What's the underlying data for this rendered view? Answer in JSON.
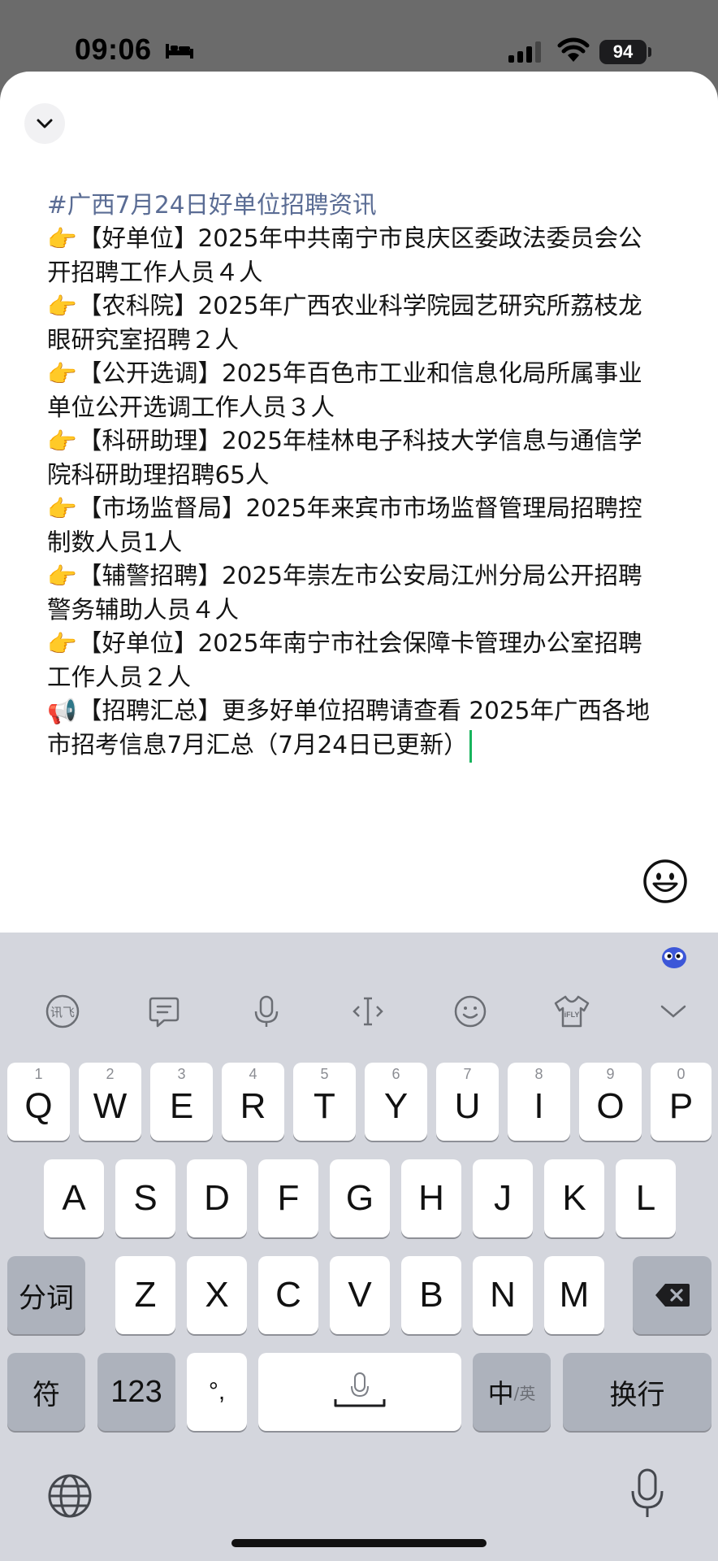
{
  "status_bar": {
    "time": "09:06",
    "battery": "94"
  },
  "editor": {
    "hashtag": "#广西7月24日好单位招聘资讯",
    "items": [
      {
        "icon": "👉",
        "text": "【好单位】2025年中共南宁市良庆区委政法委员会公开招聘工作人员４人"
      },
      {
        "icon": "👉",
        "text": "【农科院】2025年广西农业科学院园艺研究所荔枝龙眼研究室招聘２人"
      },
      {
        "icon": "👉",
        "text": "【公开选调】2025年百色市工业和信息化局所属事业单位公开选调工作人员３人"
      },
      {
        "icon": "👉",
        "text": "【科研助理】2025年桂林电子科技大学信息与通信学院科研助理招聘65人"
      },
      {
        "icon": "👉",
        "text": "【市场监督局】2025年来宾市市场监督管理局招聘控制数人员1人"
      },
      {
        "icon": "👉",
        "text": "【辅警招聘】2025年崇左市公安局江州分局公开招聘警务辅助人员４人"
      },
      {
        "icon": "👉",
        "text": "【好单位】2025年南宁市社会保障卡管理办公室招聘工作人员２人"
      },
      {
        "icon": "📢",
        "text": "【招聘汇总】更多好单位招聘请查看 2025年广西各地市招考信息7月汇总（7月24日已更新）"
      }
    ]
  },
  "keyboard": {
    "row1": [
      {
        "num": "1",
        "label": "Q"
      },
      {
        "num": "2",
        "label": "W"
      },
      {
        "num": "3",
        "label": "E"
      },
      {
        "num": "4",
        "label": "R"
      },
      {
        "num": "5",
        "label": "T"
      },
      {
        "num": "6",
        "label": "Y"
      },
      {
        "num": "7",
        "label": "U"
      },
      {
        "num": "8",
        "label": "I"
      },
      {
        "num": "9",
        "label": "O"
      },
      {
        "num": "0",
        "label": "P"
      }
    ],
    "row2": [
      "A",
      "S",
      "D",
      "F",
      "G",
      "H",
      "J",
      "K",
      "L"
    ],
    "row3": [
      "Z",
      "X",
      "C",
      "V",
      "B",
      "N",
      "M"
    ],
    "segment_key": "分词",
    "symbol_key": "符",
    "number_key": "123",
    "punct_key": "°,",
    "lang_key_main": "中",
    "lang_key_sub": "/英",
    "enter_key": "换行",
    "toolbar_icons": [
      "ifly-logo-icon",
      "clipboard-icon",
      "microphone-icon",
      "cursor-move-icon",
      "emoji-icon",
      "skin-shirt-icon",
      "chevron-down-icon"
    ],
    "toolbar_shirt_text": "iFLY"
  }
}
